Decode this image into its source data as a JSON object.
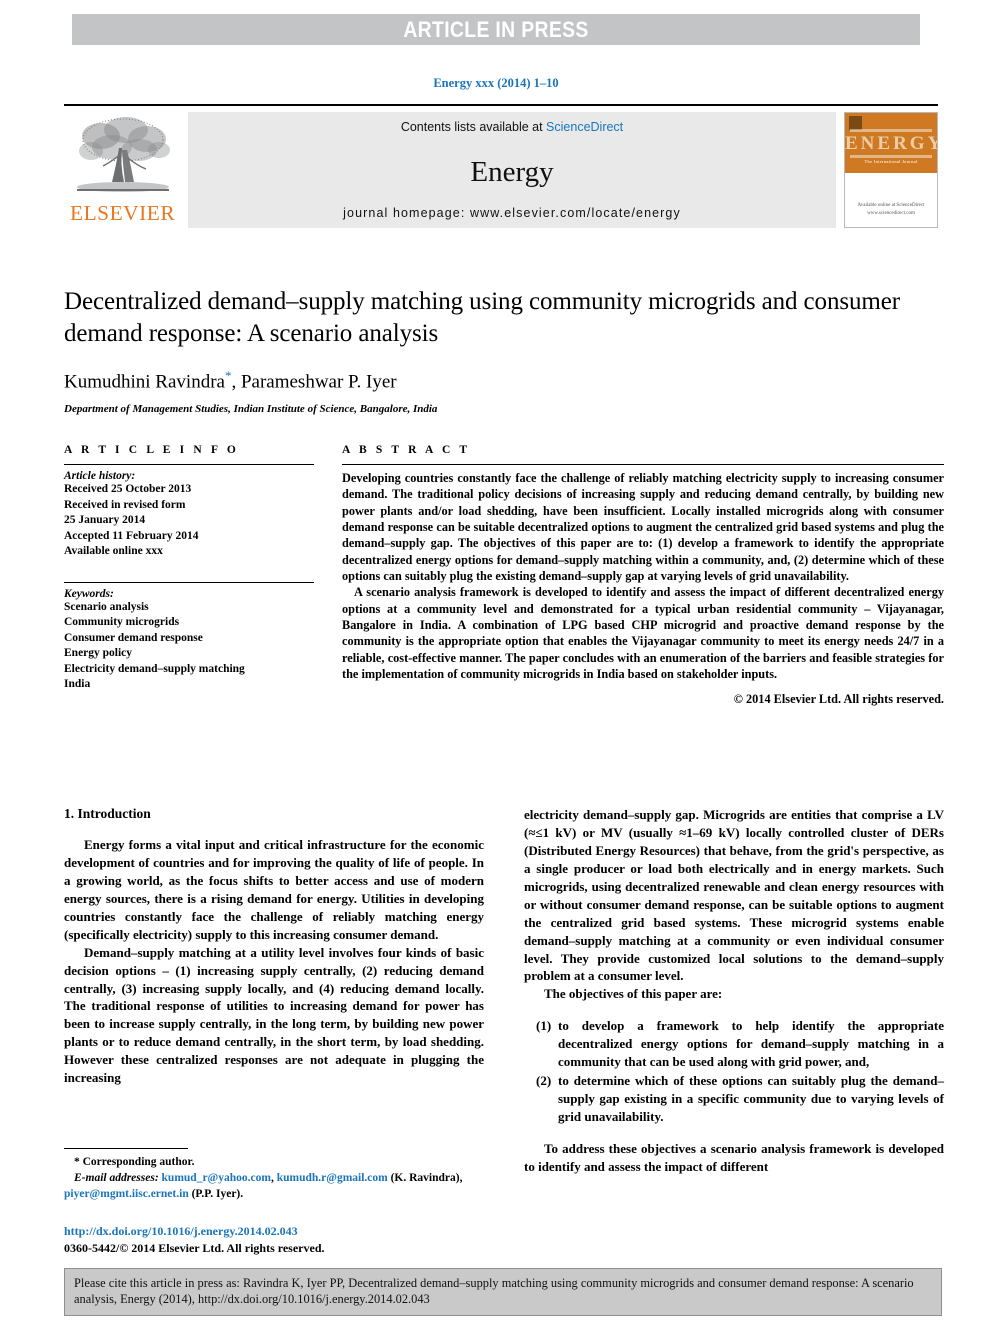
{
  "banner": {
    "press_notice": "ARTICLE IN PRESS",
    "running_head": "Energy xxx (2014) 1–10"
  },
  "masthead": {
    "publisher_name": "ELSEVIER",
    "publisher_logo_icon": "elsevier-tree-icon",
    "contents_prefix": "Contents lists available at ",
    "contents_link": "ScienceDirect",
    "journal_title": "Energy",
    "homepage": "journal homepage: www.elsevier.com/locate/energy",
    "cover": {
      "title": "ENERGY",
      "subtitle": "The International Journal",
      "footer": "Available online at\nScienceDirect\nwww.sciencedirect.com"
    }
  },
  "article": {
    "title": "Decentralized demand–supply matching using community microgrids and consumer demand response: A scenario analysis",
    "authors": "Kumudhini Ravindra",
    "author_star": "*",
    "authors_rest": ", Parameshwar P. Iyer",
    "affiliation": "Department of Management Studies, Indian Institute of Science, Bangalore, India"
  },
  "article_info": {
    "heading": "A R T I C L E   I N F O",
    "history_label": "Article history:",
    "history": [
      "Received 25 October 2013",
      "Received in revised form",
      "25 January 2014",
      "Accepted 11 February 2014",
      "Available online xxx"
    ],
    "keywords_label": "Keywords:",
    "keywords": [
      "Scenario analysis",
      "Community microgrids",
      "Consumer demand response",
      "Energy policy",
      "Electricity demand–supply matching",
      "India"
    ]
  },
  "abstract": {
    "heading": "A B S T R A C T",
    "paragraphs": [
      "Developing countries constantly face the challenge of reliably matching electricity supply to increasing consumer demand. The traditional policy decisions of increasing supply and reducing demand centrally, by building new power plants and/or load shedding, have been insufficient. Locally installed microgrids along with consumer demand response can be suitable decentralized options to augment the centralized grid based systems and plug the demand–supply gap. The objectives of this paper are to: (1) develop a framework to identify the appropriate decentralized energy options for demand–supply matching within a community, and, (2) determine which of these options can suitably plug the existing demand–supply gap at varying levels of grid unavailability.",
      "A scenario analysis framework is developed to identify and assess the impact of different decentralized energy options at a community level and demonstrated for a typical urban residential community – Vijayanagar, Bangalore in India. A combination of LPG based CHP microgrid and proactive demand response by the community is the appropriate option that enables the Vijayanagar community to meet its energy needs 24/7 in a reliable, cost-effective manner. The paper concludes with an enumeration of the barriers and feasible strategies for the implementation of community microgrids in India based on stakeholder inputs."
    ],
    "copyright": "© 2014 Elsevier Ltd. All rights reserved."
  },
  "introduction": {
    "section_title": "1. Introduction",
    "left_paragraphs": [
      "Energy forms a vital input and critical infrastructure for the economic development of countries and for improving the quality of life of people. In a growing world, as the focus shifts to better access and use of modern energy sources, there is a rising demand for energy. Utilities in developing countries constantly face the challenge of reliably matching energy (specifically electricity) supply to this increasing consumer demand.",
      "Demand–supply matching at a utility level involves four kinds of basic decision options – (1) increasing supply centrally, (2) reducing demand centrally, (3) increasing supply locally, and (4) reducing demand locally. The traditional response of utilities to increasing demand for power has been to increase supply centrally, in the long term, by building new power plants or to reduce demand centrally, in the short term, by load shedding. However these centralized responses are not adequate in plugging the increasing"
    ],
    "right_paragraph_1": "electricity demand–supply gap. Microgrids are entities that comprise a LV (≈≤1 kV) or MV (usually ≈1–69 kV) locally controlled cluster of DERs (Distributed Energy Resources) that behave, from the grid's perspective, as a single producer or load both electrically and in energy markets. Such microgrids, using decentralized renewable and clean energy resources with or without consumer demand response, can be suitable options to augment the centralized grid based systems. These microgrid systems enable demand–supply matching at a community or even individual consumer level. They provide customized local solutions to the demand–supply problem at a consumer level.",
    "objectives_lead": "The objectives of this paper are:",
    "objectives": [
      {
        "num": "(1)",
        "text": "to develop a framework to help identify the appropriate decentralized energy options for demand–supply matching in a community that can be used along with grid power, and,"
      },
      {
        "num": "(2)",
        "text": "to determine which of these options can suitably plug the demand–supply gap existing in a specific community due to varying levels of grid unavailability."
      }
    ],
    "right_paragraph_2": "To address these objectives a scenario analysis framework is developed to identify and assess the impact of different"
  },
  "footnote": {
    "corresponding": "* Corresponding author.",
    "email_label": "E-mail addresses:",
    "email_1": "kumud_r@yahoo.com",
    "email_sep": ", ",
    "email_2": "kumudh.r@gmail.com",
    "email_attrib_1": " (K. Ravindra),",
    "email_3": "piyer@mgmt.iisc.ernet.in",
    "email_attrib_2": " (P.P. Iyer).",
    "doi": "http://dx.doi.org/10.1016/j.energy.2014.02.043",
    "issn": "0360-5442/© 2014 Elsevier Ltd. All rights reserved."
  },
  "citation_box": {
    "text": "Please cite this article in press as: Ravindra K, Iyer PP, Decentralized demand–supply matching using community microgrids and consumer demand response: A scenario analysis, Energy (2014), http://dx.doi.org/10.1016/j.energy.2014.02.043"
  },
  "colors": {
    "link_blue": "#1a75bb",
    "banner_gray": "#c3c4c6",
    "elsevier_orange": "#e87722",
    "cover_orange": "#cf7a22",
    "cite_box_gray": "#c9c9c9"
  }
}
